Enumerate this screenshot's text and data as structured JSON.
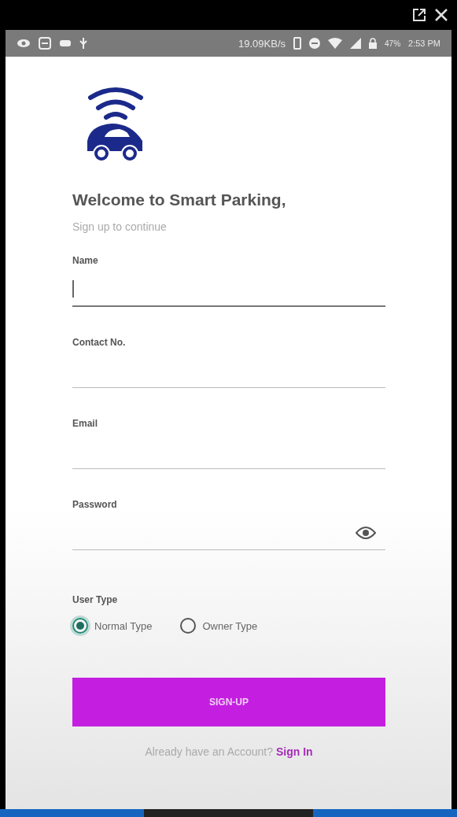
{
  "status_bar": {
    "speed": "19.09KB/s",
    "battery": "47%",
    "time": "2:53 PM"
  },
  "title": "Welcome to Smart Parking,",
  "subtitle": "Sign up to continue",
  "fields": [
    {
      "label": "Name",
      "kind": "text",
      "focused": true
    },
    {
      "label": "Contact No.",
      "kind": "text",
      "focused": false
    },
    {
      "label": "Email",
      "kind": "text",
      "focused": false
    },
    {
      "label": "Password",
      "kind": "password",
      "focused": false
    }
  ],
  "user_type": {
    "label": "User Type",
    "options": [
      {
        "label": "Normal Type",
        "selected": true
      },
      {
        "label": "Owner Type",
        "selected": false
      }
    ]
  },
  "signup_button": "SIGN-UP",
  "signin_prompt": {
    "text": "Already have an Account?",
    "link": "Sign In"
  }
}
